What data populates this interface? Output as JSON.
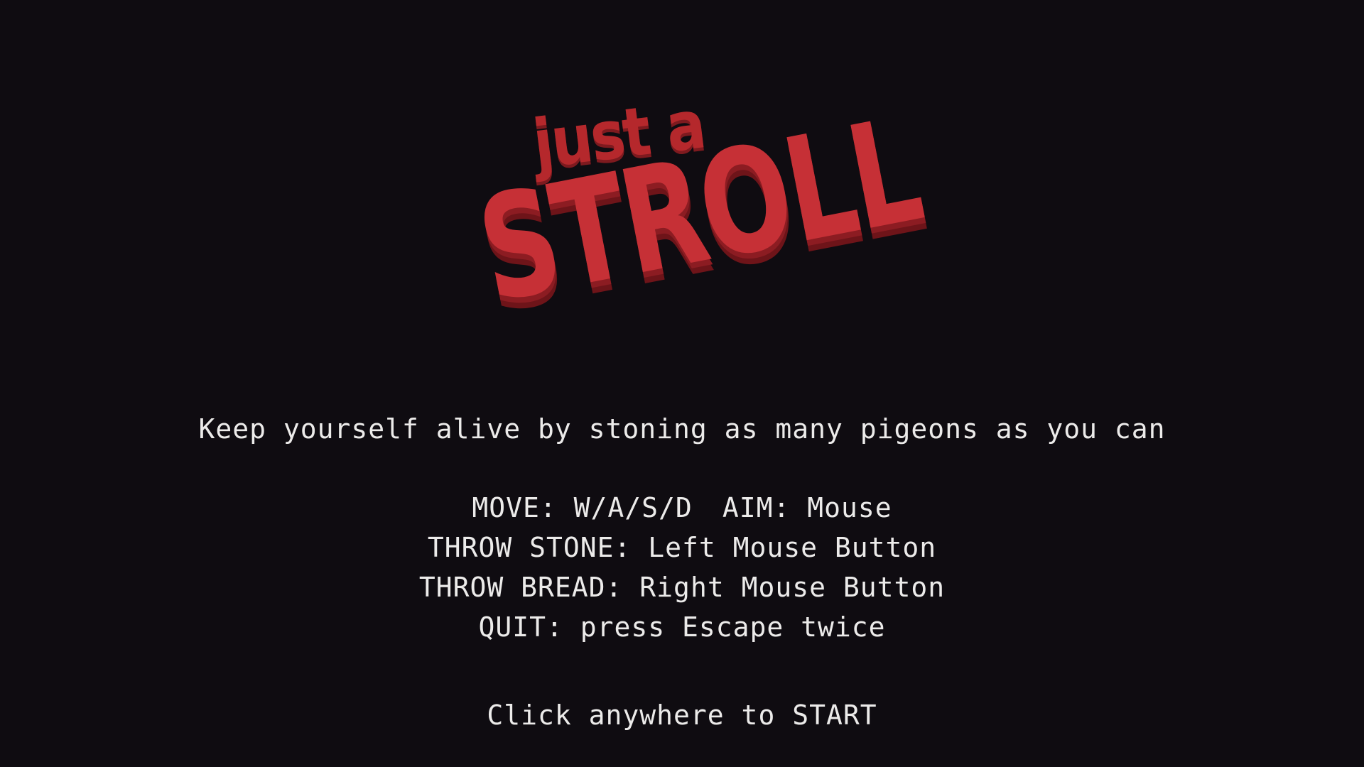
{
  "logo": {
    "small": "just a",
    "big": "STROLL"
  },
  "tagline": "Keep yourself alive by stoning as many pigeons as you can",
  "controls": {
    "move": "MOVE: W/A/S/D",
    "aim": "AIM: Mouse",
    "throw_stone": "THROW STONE: Left Mouse Button",
    "throw_bread": "THROW BREAD: Right Mouse Button",
    "quit": "QUIT: press Escape twice"
  },
  "start_prompt": "Click anywhere to START",
  "colors": {
    "background": "#0f0c11",
    "logo_red": "#c63036",
    "text": "#ecebea"
  }
}
